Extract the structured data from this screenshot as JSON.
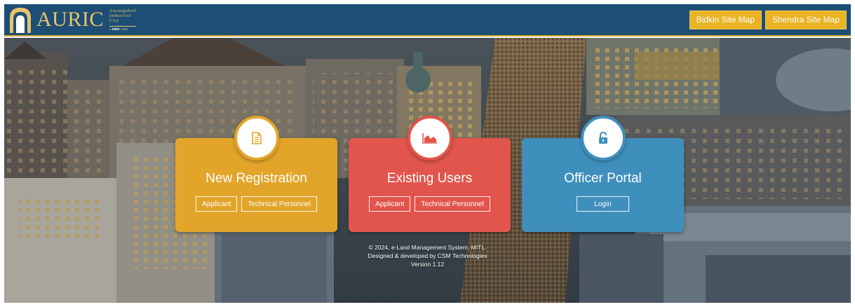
{
  "header": {
    "brand": {
      "wordmark": "AURIC",
      "subtitle_lines": [
        "Aurangabad",
        "Industrial",
        "City"
      ],
      "tagline_prefix": "a",
      "tagline_org": "DMIC",
      "tagline_suffix": "node"
    },
    "nav": {
      "bidkin_label": "Bidkin Site Map",
      "shendra_label": "Shendra Site Map"
    }
  },
  "cards": {
    "new_registration": {
      "title": "New Registration",
      "icon": "document-icon",
      "buttons": [
        "Applicant",
        "Technical Personnel"
      ],
      "color": "#e2a52a"
    },
    "existing_users": {
      "title": "Existing Users",
      "icon": "area-chart-icon",
      "buttons": [
        "Applicant",
        "Technical Personnel"
      ],
      "color": "#e1554c"
    },
    "officer_portal": {
      "title": "Officer Portal",
      "icon": "unlock-icon",
      "buttons": [
        "Login"
      ],
      "color": "#3f8fbc"
    }
  },
  "footer": {
    "line1": "© 2024, e-Land Management System, MITL.",
    "line2": "Designed & developed by CSM Technologies",
    "line3": "Version 1.12"
  },
  "colors": {
    "header_bg": "#1d4e75",
    "gold": "#e8b325"
  }
}
